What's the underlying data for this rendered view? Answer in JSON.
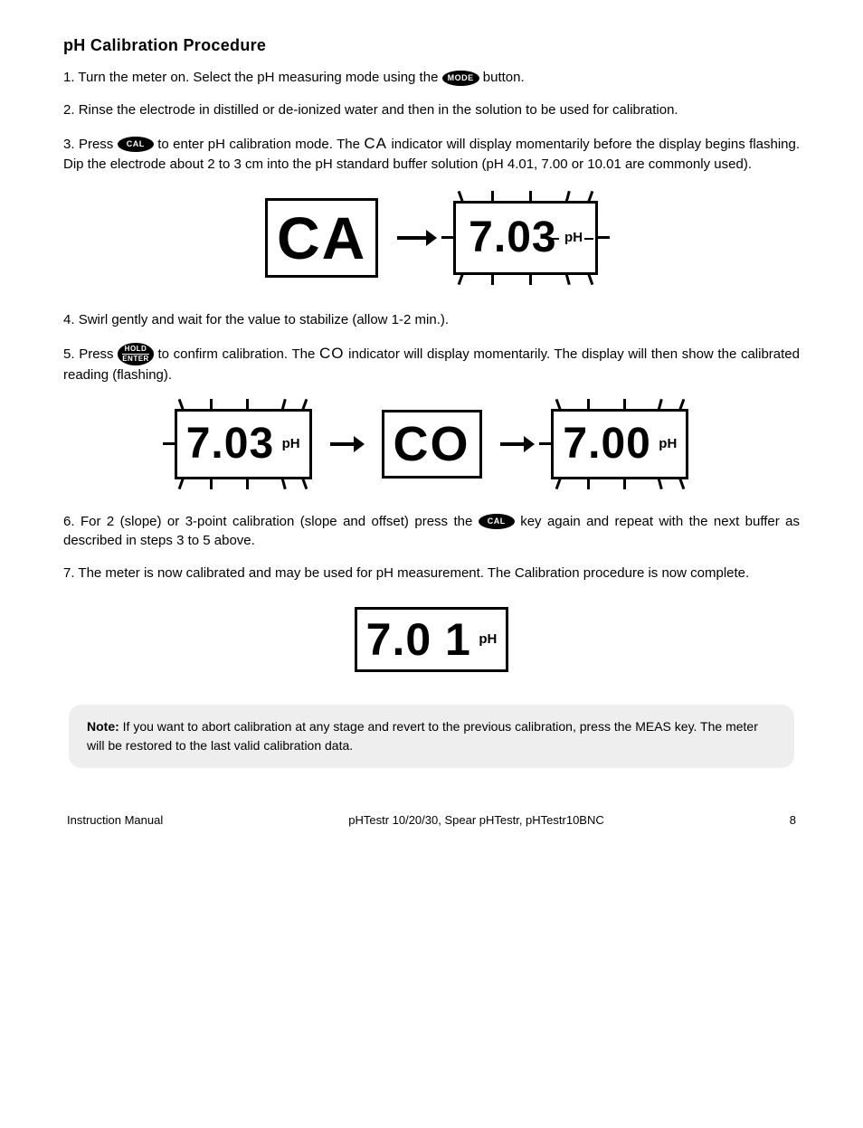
{
  "title": "pH Calibration Procedure",
  "steps": {
    "s1": {
      "num": "1.",
      "text_a": "Turn the meter on. Select the pH measuring mode using the ",
      "text_b": " button."
    },
    "s2": {
      "num": "2.",
      "text_a": "Rinse the electrode in distilled or de-ionized water and then in the solution to be used for calibration."
    },
    "s3": {
      "num": "3.",
      "text_a": "Press ",
      "text_b": " to enter pH calibration mode. The ",
      "text_c": " indicator will display momentarily before the display begins flashing. Dip the electrode about 2 to 3 cm into the pH standard buffer solution (pH 4.01, 7.00 or 10.01 are commonly used)."
    },
    "s4": {
      "num": "4.",
      "text_a": "Swirl gently and wait for the value to stabilize (allow 1-2 min.)."
    },
    "s5": {
      "num": "5.",
      "text_a": "Press ",
      "text_b": " to confirm calibration. The ",
      "text_c": " indicator will display momentarily. The display will then show the calibrated reading (flashing)."
    },
    "s6": {
      "num": "6.",
      "text_a": "For 2 (slope) or 3-point calibration (slope and offset) press the ",
      "text_b": " key again and repeat with the next buffer as described in steps 3 to 5 above."
    },
    "s7": {
      "num": "7.",
      "text_a": "The meter is now calibrated and may be used for pH measurement. The Calibration procedure is now complete."
    }
  },
  "button_labels": {
    "mode": "MODE",
    "cal": "CAL",
    "hold_top": "HOLD",
    "hold_bot": "ENTER"
  },
  "seg_labels": {
    "CA": "CA",
    "CO": "CO"
  },
  "lcd": {
    "ca": "CA",
    "r1_val": "7.03",
    "r1_unit": "pH",
    "r2a_val": "7.03",
    "r2a_unit": "pH",
    "co": "CO",
    "r2b_val": "7.00",
    "r2b_unit": "pH",
    "final_val": "7.0 1",
    "final_unit": "pH"
  },
  "note": {
    "label": "Note:",
    "text": " If you want to abort calibration at any stage and revert to the previous calibration, press the MEAS key. The meter will be restored to the last valid calibration data."
  },
  "footer": {
    "left": "Instruction Manual",
    "center": "pHTestr 10/20/30, Spear pHTestr, pHTestr10BNC",
    "right": "8"
  }
}
